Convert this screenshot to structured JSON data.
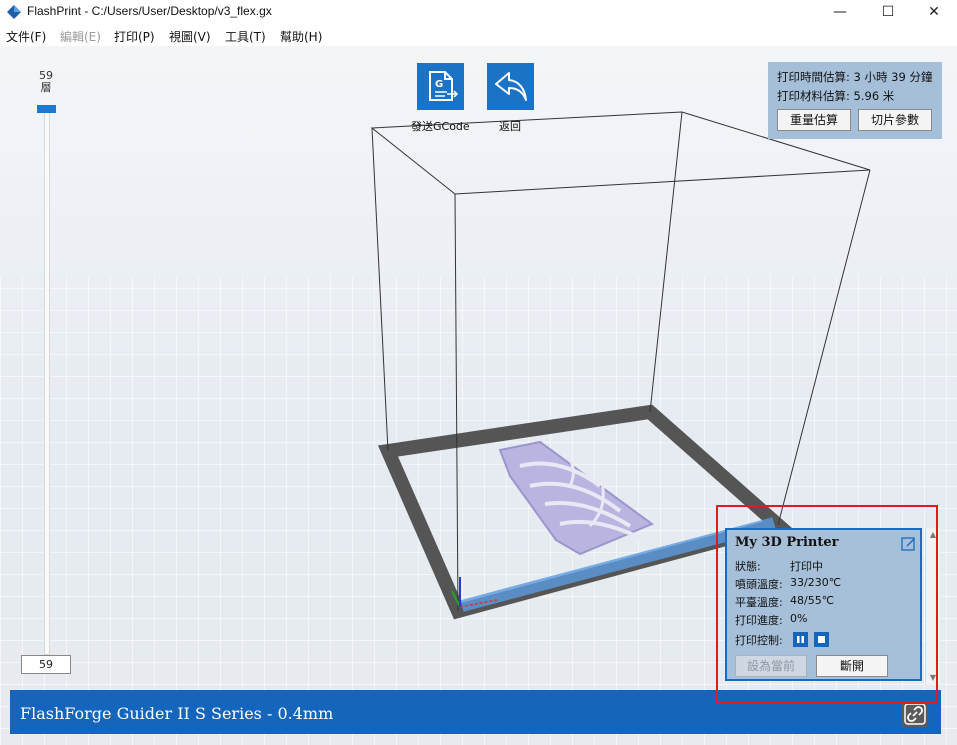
{
  "window": {
    "title": "FlashPrint - C:/Users/User/Desktop/v3_flex.gx",
    "minimize": "—",
    "maximize": "☐",
    "close": "✕"
  },
  "menu": {
    "items": [
      {
        "label": "文件(F)",
        "enabled": true
      },
      {
        "label": "編輯(E)",
        "enabled": false
      },
      {
        "label": "打印(P)",
        "enabled": true
      },
      {
        "label": "視圖(V)",
        "enabled": true
      },
      {
        "label": "工具(T)",
        "enabled": true
      },
      {
        "label": "幫助(H)",
        "enabled": true
      }
    ]
  },
  "layer_slider": {
    "top_value": "59",
    "top_unit": "層",
    "input_value": "59"
  },
  "toolbar": {
    "send_gcode_label": "發送GCode",
    "back_label": "返回"
  },
  "estimate": {
    "time_line": "打印時間估算: 3 小時 39 分鐘",
    "material_line": "打印材料估算: 5.96 米",
    "weight_button": "重量估算",
    "slice_button": "切片參數"
  },
  "printer": {
    "name": "My 3D Printer",
    "status_label": "狀態:",
    "status_value": "打印中",
    "nozzle_label": "噴頭溫度:",
    "nozzle_value": "33/230℃",
    "bed_label": "平臺溫度:",
    "bed_value": "48/55℃",
    "progress_label": "打印進度:",
    "progress_value": "0%",
    "control_label": "打印控制:",
    "set_current_button": "設為當前",
    "disconnect_button": "斷開"
  },
  "status_bar": {
    "text": "FlashForge Guider II S Series - 0.4mm"
  },
  "colors": {
    "accent": "#1b73c8",
    "status_bar": "#1465bb",
    "panel": "#a7c0d9",
    "highlight": "#e01b1b",
    "model": "#b9b5e0"
  }
}
